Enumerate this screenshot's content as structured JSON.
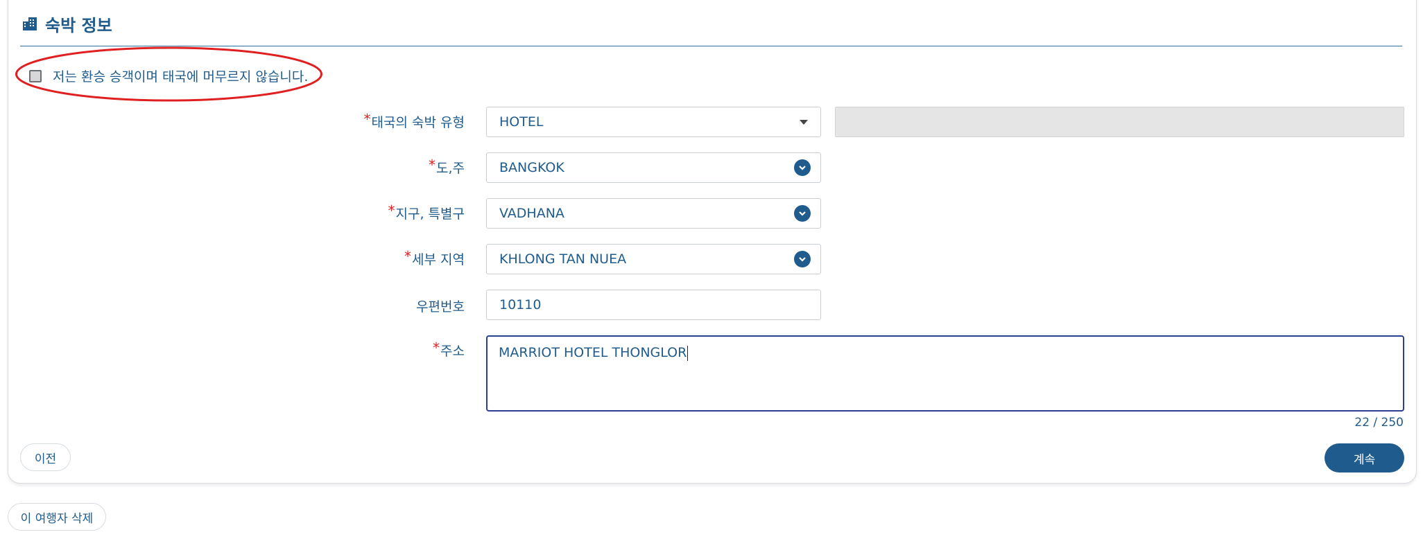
{
  "section": {
    "title": "숙박 정보",
    "icon": "building-icon"
  },
  "transit": {
    "label": "저는 환승 승객이며 태국에 머무르지 않습니다.",
    "checked": false
  },
  "fields": {
    "accommodation_type": {
      "label": "태국의 숙박 유형",
      "required": true,
      "value": "HOTEL",
      "other_value": ""
    },
    "province": {
      "label": "도,주",
      "required": true,
      "value": "BANGKOK"
    },
    "district": {
      "label": "지구, 특별구",
      "required": true,
      "value": "VADHANA"
    },
    "subdistrict": {
      "label": "세부 지역",
      "required": true,
      "value": "KHLONG TAN NUEA"
    },
    "postal_code": {
      "label": "우편번호",
      "required": false,
      "value": "10110"
    },
    "address": {
      "label": "주소",
      "required": true,
      "value": "MARRIOT HOTEL THONGLOR",
      "counter": "22 / 250"
    }
  },
  "buttons": {
    "previous": "이전",
    "continue": "계속",
    "delete_traveler": "이 여행자 삭제"
  },
  "colors": {
    "primary": "#1f5b8c",
    "required": "#e02020",
    "highlight": "#e02020",
    "disabled_bg": "#e5e5e5"
  }
}
